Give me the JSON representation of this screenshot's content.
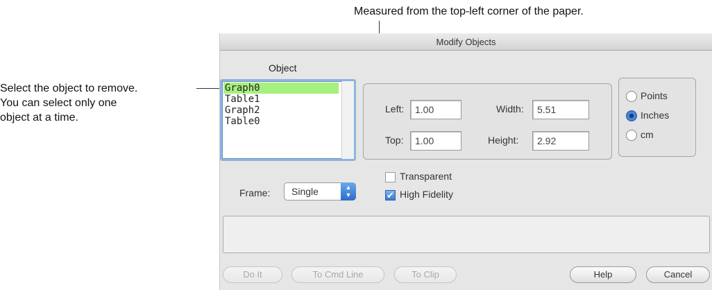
{
  "annotations": {
    "top": "Measured from the top-left corner of the paper.",
    "left": [
      "Select the object to remove.",
      "You can select only one",
      "object at a time."
    ]
  },
  "dialog": {
    "title": "Modify Objects",
    "object_label": "Object",
    "objects": [
      "Graph0",
      "Table1",
      "Graph2",
      "Table0"
    ],
    "selected_object": "Graph0",
    "position": {
      "left_label": "Left:",
      "left_value": "1.00",
      "top_label": "Top:",
      "top_value": "1.00",
      "width_label": "Width:",
      "width_value": "5.51",
      "height_label": "Height:",
      "height_value": "2.92"
    },
    "units": {
      "options": [
        "Points",
        "Inches",
        "cm"
      ],
      "selected": "Inches"
    },
    "frame": {
      "label": "Frame:",
      "value": "Single"
    },
    "transparent": {
      "label": "Transparent",
      "checked": false
    },
    "high_fidelity": {
      "label": "High Fidelity",
      "checked": true
    },
    "buttons": {
      "do_it": "Do It",
      "to_cmd_line": "To Cmd Line",
      "to_clip": "To Clip",
      "help": "Help",
      "cancel": "Cancel"
    }
  },
  "colors": {
    "selection": "#a6f080",
    "focus_ring": "#8cb4e2",
    "accent": "#2f6bc5"
  }
}
